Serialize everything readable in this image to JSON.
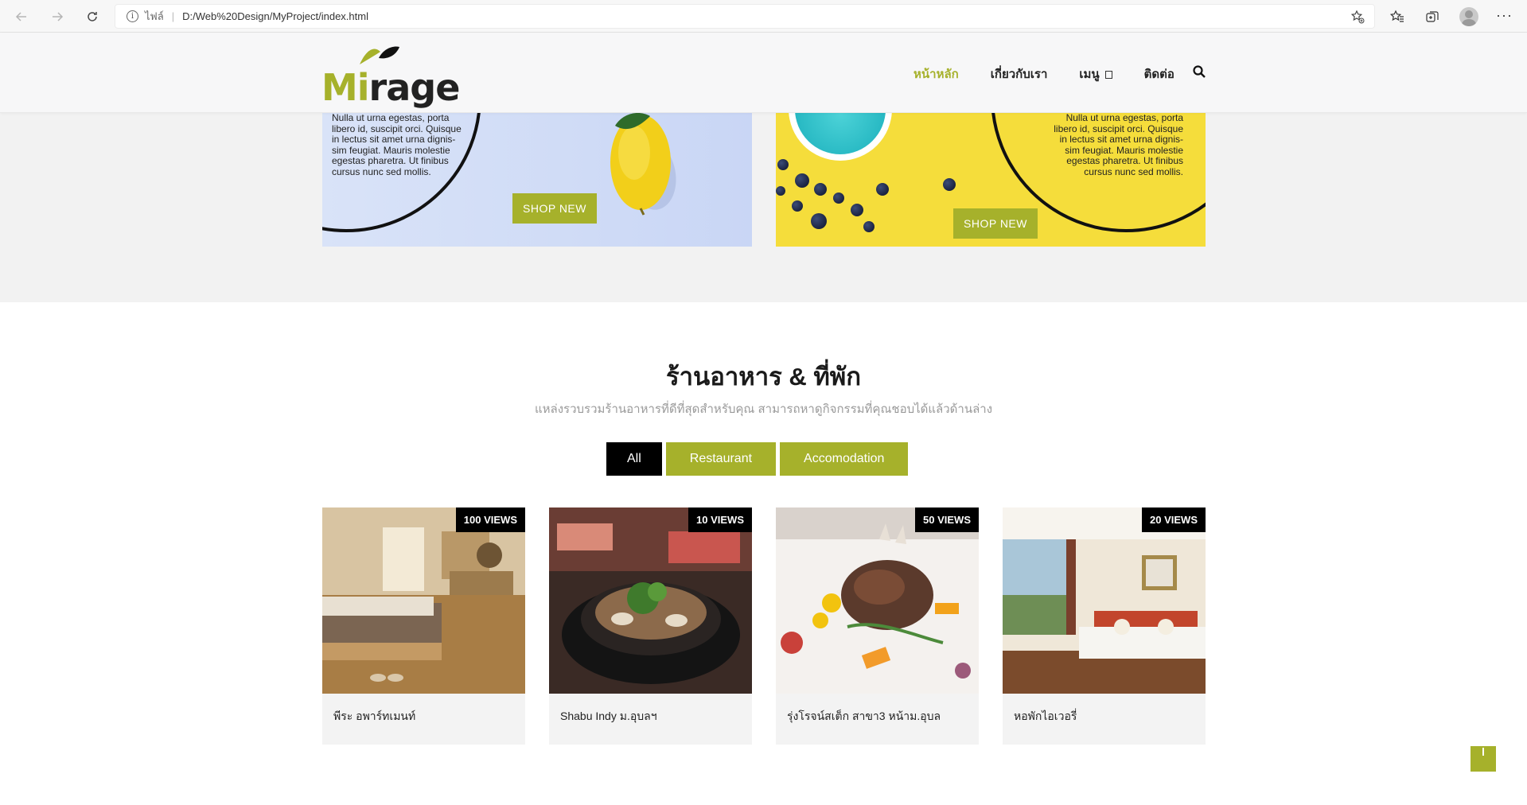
{
  "browser": {
    "scheme_label": "ไฟล์",
    "url": "D:/Web%20Design/MyProject/index.html"
  },
  "header": {
    "logo_part1": "Mi",
    "logo_part2": "rage",
    "nav": [
      "หน้าหลัก",
      "เกี่ยวกับเรา",
      "เมนู",
      "ติดต่อ"
    ],
    "accent_color": "#a6b12b"
  },
  "banners": [
    {
      "text": "Nulla ut urna egestas, porta\nlibero id, suscipit orci. Quisque\nin lectus sit amet urna dignis-\nsim feugiat. Mauris molestie\negestas pharetra. Ut finibus\ncursus nunc sed mollis.",
      "button": "SHOP NEW"
    },
    {
      "text": "Nulla ut urna egestas, porta\nlibero id, suscipit orci. Quisque\nin lectus sit amet urna dignis-\nsim feugiat. Mauris molestie\negestas pharetra. Ut finibus\ncursus nunc sed mollis.",
      "button": "SHOP NEW"
    }
  ],
  "section": {
    "title": "ร้านอาหาร & ที่พัก",
    "subtitle": "แหล่งรวบรวมร้านอาหารที่ดีที่สุดสำหรับคุณ สามารถหาดูกิจกรรมที่คุณชอบได้แล้วด้านล่าง",
    "filters": [
      "All",
      "Restaurant",
      "Accomodation"
    ]
  },
  "cards": [
    {
      "views": "100 VIEWS",
      "title": "พีระ อพาร์ทเมนท์"
    },
    {
      "views": "10 VIEWS",
      "title": "Shabu Indy ม.อุบลฯ"
    },
    {
      "views": "50 VIEWS",
      "title": "รุ่งโรจน์สเต็ก สาขา3 หน้าม.อุบล"
    },
    {
      "views": "20 VIEWS",
      "title": "หอพักไอเวอรี่"
    }
  ]
}
